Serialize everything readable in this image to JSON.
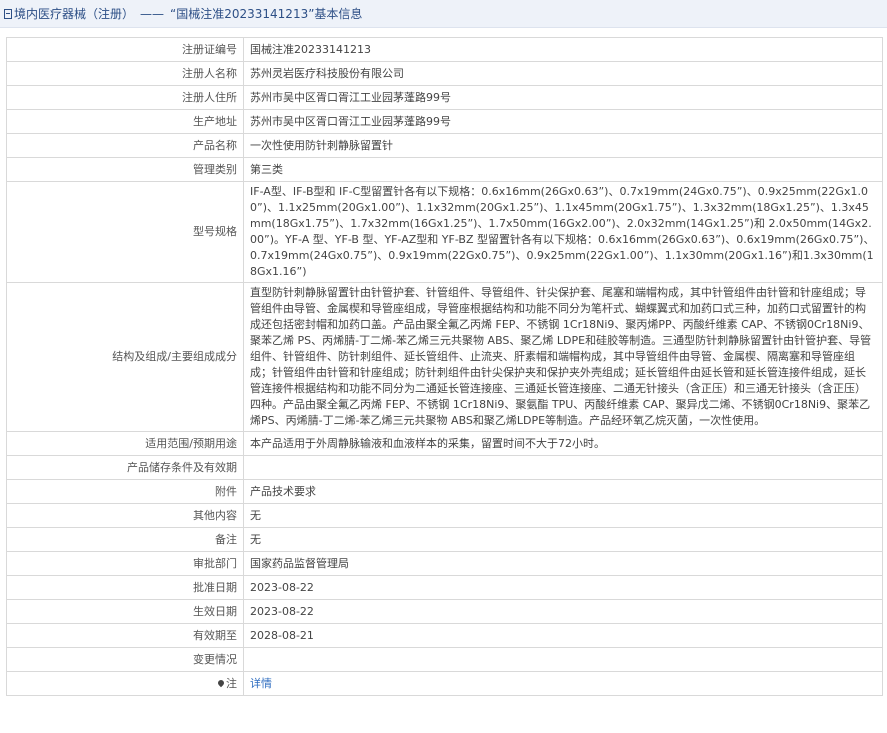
{
  "header": {
    "crumb": "境内医疗器械（注册）",
    "separator": "——",
    "title": "“国械注准20233141213”基本信息"
  },
  "fields": {
    "reg_no_label": "注册证编号",
    "reg_no": "国械注准20233141213",
    "registrant_label": "注册人名称",
    "registrant": "苏州灵岩医疗科技股份有限公司",
    "address_label": "注册人住所",
    "address": "苏州市吴中区胥口胥江工业园茅蓬路99号",
    "prod_addr_label": "生产地址",
    "prod_addr": "苏州市吴中区胥口胥江工业园茅蓬路99号",
    "product_label": "产品名称",
    "product": "一次性使用防针刺静脉留置针",
    "category_label": "管理类别",
    "category": "第三类",
    "model_label": "型号规格",
    "model": "IF-A型、IF-B型和 IF-C型留置针各有以下规格：0.6x16mm(26Gx0.63”)、0.7x19mm(24Gx0.75”)、0.9x25mm(22Gx1.00”)、1.1x25mm(20Gx1.00”)、1.1x32mm(20Gx1.25”)、1.1x45mm(20Gx1.75”)、1.3x32mm(18Gx1.25”)、1.3x45mm(18Gx1.75”)、1.7x32mm(16Gx1.25”)、1.7x50mm(16Gx2.00”)、2.0x32mm(14Gx1.25”)和 2.0x50mm(14Gx2.00”)。YF-A 型、YF-B 型、YF-AZ型和 YF-BZ 型留置针各有以下规格：0.6x16mm(26Gx0.63”)、0.6x19mm(26Gx0.75”)、0.7x19mm(24Gx0.75”)、0.9x19mm(22Gx0.75”)、0.9x25mm(22Gx1.00”)、1.1x30mm(20Gx1.16”)和1.3x30mm(18Gx1.16”)",
    "structure_label": "结构及组成/主要组成成分",
    "structure": "直型防针刺静脉留置针由针管护套、针管组件、导管组件、针尖保护套、尾塞和端帽构成，其中针管组件由针管和针座组成；导管组件由导管、金属楔和导管座组成，导管座根据结构和功能不同分为笔杆式、蝴蝶翼式和加药口式三种，加药口式留置针的构成还包括密封帽和加药口盖。产品由聚全氟乙丙烯 FEP、不锈钢 1Cr18Ni9、聚丙烯PP、丙酸纤维素 CAP、不锈钢0Cr18Ni9、聚苯乙烯 PS、丙烯腈-丁二烯-苯乙烯三元共聚物 ABS、聚乙烯 LDPE和硅胶等制造。三通型防针刺静脉留置针由针管护套、导管组件、针管组件、防针刺组件、延长管组件、止流夹、肝素帽和端帽构成，其中导管组件由导管、金属楔、隔离塞和导管座组成；针管组件由针管和针座组成；防针刺组件由针尖保护夹和保护夹外壳组成；延长管组件由延长管和延长管连接件组成，延长管连接件根据结构和功能不同分为二通延长管连接座、三通延长管连接座、二通无针接头（含正压）和三通无针接头（含正压）四种。产品由聚全氟乙丙烯 FEP、不锈钢 1Cr18Ni9、聚氨酯 TPU、丙酸纤维素 CAP、聚异戊二烯、不锈钢0Cr18Ni9、聚苯乙烯PS、丙烯腈-丁二烯-苯乙烯三元共聚物 ABS和聚乙烯LDPE等制造。产品经环氧乙烷灭菌，一次性使用。",
    "scope_label": "适用范围/预期用途",
    "scope": "本产品适用于外周静脉输液和血液样本的采集，留置时间不大于72小时。",
    "storage_label": "产品储存条件及有效期",
    "storage": "",
    "attachment_label": "附件",
    "attachment": "产品技术要求",
    "other_label": "其他内容",
    "other": "无",
    "remark_label": "备注",
    "remark": "无",
    "dept_label": "审批部门",
    "dept": "国家药品监督管理局",
    "approve_date_label": "批准日期",
    "approve_date": "2023-08-22",
    "effective_date_label": "生效日期",
    "effective_date": "2023-08-22",
    "expiry_label": "有效期至",
    "expiry": "2028-08-21",
    "change_label": "变更情况",
    "change": "",
    "note_label": "注",
    "note_link": "详情"
  }
}
